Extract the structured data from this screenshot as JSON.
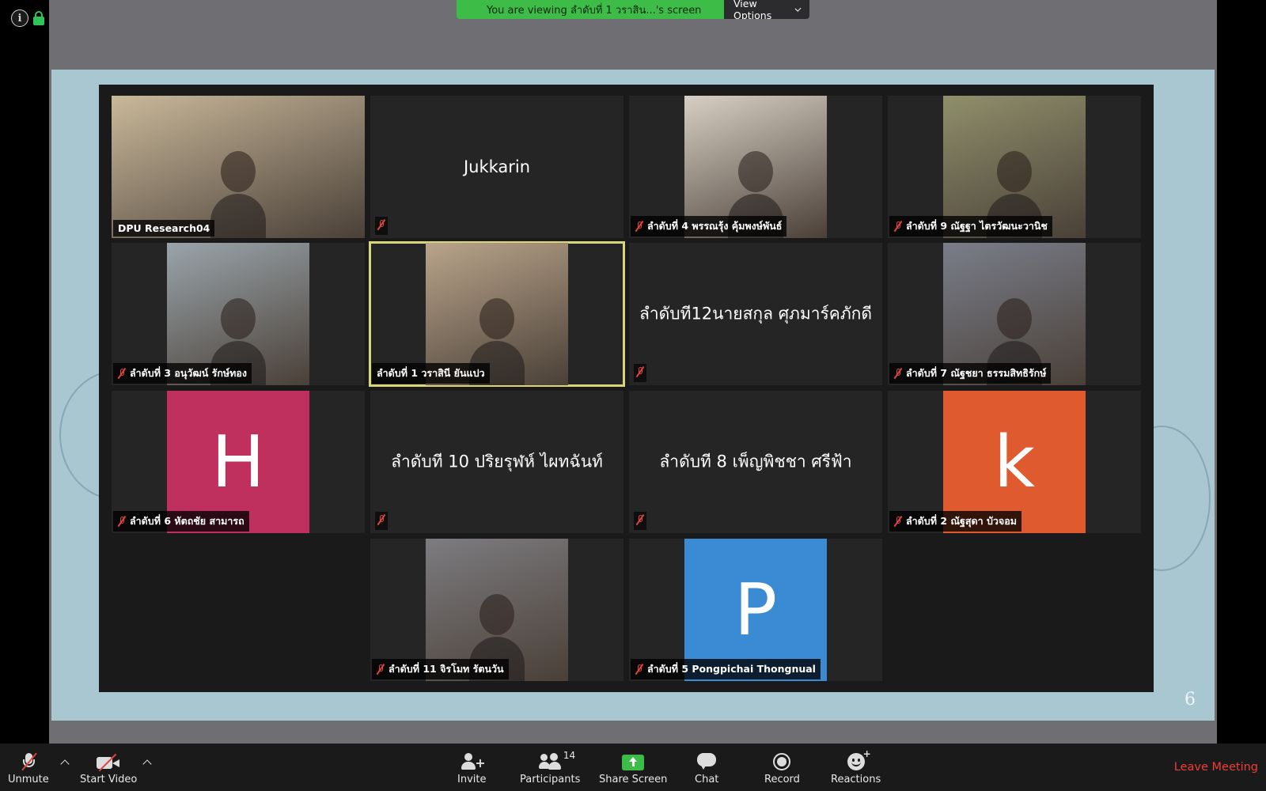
{
  "banner": {
    "viewing_text": "You are viewing ลำดับที่ 1 วราสิน...'s screen",
    "view_options_label": "View Options"
  },
  "slide": {
    "page_number": "6"
  },
  "participants": [
    {
      "label": "DPU Research04",
      "type": "video",
      "muted": false,
      "photo_color": "#c9b89a"
    },
    {
      "label": "Jukkarin",
      "type": "name",
      "muted": true,
      "center_text": "Jukkarin"
    },
    {
      "label": "ลำดับที่ 4 พรรณรุ้ง คุ้มพงษ์พันธ์",
      "type": "video",
      "muted": true,
      "photo_color": "#d8cfc4"
    },
    {
      "label": "ลำดับที่ 9 ณัฐฐา ไตรวัฒนะวานิช",
      "type": "video",
      "muted": true,
      "photo_color": "#8f8f6b"
    },
    {
      "label": "ลำดับที่ 3 อนุวัฒน์ รักษ์ทอง",
      "type": "video",
      "muted": true,
      "photo_color": "#9aa4aa"
    },
    {
      "label": "ลำดับที่ 1 วราสินี ยันแปว",
      "type": "video",
      "muted": false,
      "active": true,
      "photo_color": "#b9a48a"
    },
    {
      "label": "ลำดับที12นายสกุล ศุภมาร์คภักดี",
      "type": "name",
      "muted": true,
      "center_text": "ลำดับที12นายสกุล ศุภมาร์คภักดี"
    },
    {
      "label": "ลำดับที่ 7 ณัฐชยา ธรรมสิทธิรักษ์",
      "type": "video",
      "muted": true,
      "photo_color": "#7a7e8a"
    },
    {
      "label": "ลำดับที่ 6 หัตถชัย สามารถ",
      "type": "avatar",
      "muted": true,
      "initial": "H",
      "avatar_color": "#c0305e"
    },
    {
      "label": "ลำดับที 10 ปริยรุฬห์ ไผทฉันท์",
      "type": "name",
      "muted": true,
      "center_text": "ลำดับที 10 ปริยรุฬห์ ไผทฉันท์"
    },
    {
      "label": "ลำดับที 8 เพ็ญพิชชา ศรีฟ้า",
      "type": "name",
      "muted": true,
      "center_text": "ลำดับที 8 เพ็ญพิชชา ศรีฟ้า"
    },
    {
      "label": "ลำดับที่ 2 ณัฐสุดา บัวจอม",
      "type": "avatar",
      "muted": true,
      "initial": "k",
      "avatar_color": "#e05a30"
    },
    {
      "label": "ลำดับที่ 11 จิรโมท รัตนวัน",
      "type": "video",
      "muted": true,
      "photo_color": "#7d7c80"
    },
    {
      "label": "ลำดับที่ 5 Pongpichai Thongnual",
      "type": "avatar",
      "muted": true,
      "initial": "P",
      "avatar_color": "#3a8bd4"
    }
  ],
  "toolbar": {
    "unmute_label": "Unmute",
    "start_video_label": "Start Video",
    "invite_label": "Invite",
    "participants_label": "Participants",
    "participants_count": "14",
    "share_screen_label": "Share Screen",
    "chat_label": "Chat",
    "record_label": "Record",
    "reactions_label": "Reactions",
    "leave_label": "Leave Meeting"
  },
  "colors": {
    "banner_green": "#3dbd47",
    "active_speaker_outline": "#d8d57a",
    "leave_red": "#ef3e36",
    "slide_background": "#a9c7d0"
  }
}
